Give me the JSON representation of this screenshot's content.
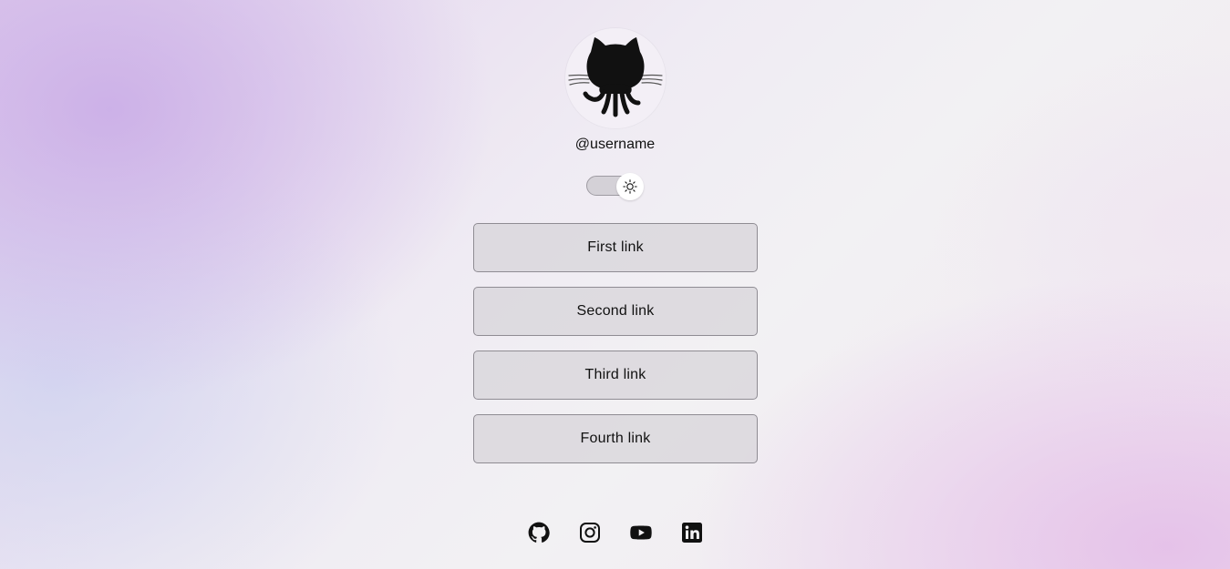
{
  "profile": {
    "username": "@username",
    "avatar_icon": "github-octocat-icon"
  },
  "theme_toggle": {
    "state": "light",
    "icon": "sun-icon"
  },
  "links": [
    {
      "label": "First link"
    },
    {
      "label": "Second link"
    },
    {
      "label": "Third link"
    },
    {
      "label": "Fourth link"
    }
  ],
  "social": [
    {
      "icon": "github-icon"
    },
    {
      "icon": "instagram-icon"
    },
    {
      "icon": "youtube-icon"
    },
    {
      "icon": "linkedin-icon"
    }
  ],
  "colors": {
    "background_primary": "#e2d1ee",
    "button_fill": "#d7d4da",
    "button_border": "#8f8c93",
    "text": "#111111"
  }
}
